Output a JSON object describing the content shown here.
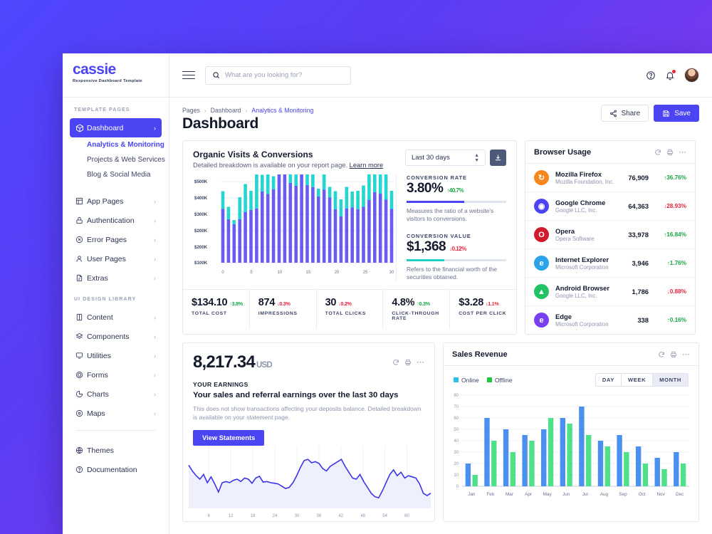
{
  "brand": {
    "name": "cassie",
    "tagline": "Responsive Dashboard Template",
    "accent": "#4a44f2"
  },
  "search": {
    "placeholder": "What are you looking for?",
    "value": ""
  },
  "topbar": {
    "help_icon": "help-circle-icon",
    "bell_icon": "bell-icon",
    "menu_icon": "hamburger-icon"
  },
  "sidebar": {
    "caption_1": "TEMPLATE PAGES",
    "caption_2": "UI DESIGN LIBRARY",
    "items_1": [
      {
        "label": "Dashboard",
        "icon": "cube-icon",
        "active": true,
        "chevron": "›"
      },
      {
        "label": "App Pages",
        "icon": "layout-icon",
        "chevron": "›"
      },
      {
        "label": "Authentication",
        "icon": "lock-icon",
        "chevron": "›"
      },
      {
        "label": "Error Pages",
        "icon": "error-circle-icon",
        "chevron": "›"
      },
      {
        "label": "User Pages",
        "icon": "user-icon",
        "chevron": "›"
      },
      {
        "label": "Extras",
        "icon": "file-icon",
        "chevron": "›"
      }
    ],
    "sub_items": [
      {
        "label": "Analytics & Monitoring",
        "current": true
      },
      {
        "label": "Projects & Web Services",
        "current": false
      },
      {
        "label": "Blog & Social Media",
        "current": false
      }
    ],
    "items_2": [
      {
        "label": "Content",
        "icon": "book-icon",
        "chevron": "›"
      },
      {
        "label": "Components",
        "icon": "layers-icon",
        "chevron": "›"
      },
      {
        "label": "Utilities",
        "icon": "monitor-icon",
        "chevron": "›"
      },
      {
        "label": "Forms",
        "icon": "form-icon",
        "chevron": "›"
      },
      {
        "label": "Charts",
        "icon": "pie-chart-icon",
        "chevron": "›"
      },
      {
        "label": "Maps",
        "icon": "map-pin-icon",
        "chevron": "›"
      }
    ],
    "items_3": [
      {
        "label": "Themes",
        "icon": "palette-icon"
      },
      {
        "label": "Documentation",
        "icon": "question-circle-icon"
      }
    ]
  },
  "breadcrumb": {
    "items": [
      "Pages",
      "Dashboard"
    ],
    "current": "Analytics & Monitoring",
    "sep": "›"
  },
  "page": {
    "title": "Dashboard"
  },
  "actions": {
    "share": "Share",
    "save": "Save",
    "share_icon": "share-icon",
    "save_icon": "save-disk-icon"
  },
  "organic": {
    "title": "Organic Visits & Conversions",
    "subtitle": "Detailed breakdown is available on your report page.",
    "link": "Learn more",
    "range_value": "Last 30 days",
    "download_icon": "download-icon",
    "conversion_rate": {
      "caption": "CONVERSION RATE",
      "value": "3.80%",
      "delta": "40.7%",
      "direction": "up",
      "bar_pct": 58,
      "bar_color": "#4a44f2",
      "note": "Measures the ratio of a website's visitors to conversions."
    },
    "conversion_value": {
      "caption": "CONVERSION VALUE",
      "value": "$1,368",
      "delta": "0.12%",
      "direction": "down",
      "bar_pct": 38,
      "bar_color": "#1fd0c8",
      "note": "Refers to the financial worth of the securities obtained."
    },
    "stats": [
      {
        "value": "$134.10",
        "delta": "3.8%",
        "direction": "up",
        "label": "TOTAL COST"
      },
      {
        "value": "874",
        "delta": "0.3%",
        "direction": "down",
        "label": "IMPRESSIONS"
      },
      {
        "value": "30",
        "delta": "0.2%",
        "direction": "down",
        "label": "TOTAL CLICKS"
      },
      {
        "value": "4.8%",
        "delta": "0.3%",
        "direction": "up",
        "label": "CLICK-THROUGH RATE"
      },
      {
        "value": "$3.28",
        "delta": "1.1%",
        "direction": "down",
        "label": "COST PER CLICK"
      }
    ]
  },
  "browser": {
    "title": "Browser Usage",
    "icons": [
      "refresh-icon",
      "print-icon",
      "more-icon"
    ],
    "rows": [
      {
        "name": "Mozilla Firefox",
        "company": "Mozilla Foundation, Inc.",
        "count": "76,909",
        "pct": "36.76%",
        "direction": "up",
        "color": "#f7861c",
        "glyph": "↻"
      },
      {
        "name": "Google Chrome",
        "company": "Google LLC, Inc.",
        "count": "64,363",
        "pct": "28.93%",
        "direction": "down",
        "color": "#4a44f2",
        "glyph": "◉"
      },
      {
        "name": "Opera",
        "company": "Opera Software",
        "count": "33,978",
        "pct": "16.84%",
        "direction": "up",
        "color": "#d01b2a",
        "glyph": "O"
      },
      {
        "name": "Internet Explorer",
        "company": "Microsoft Corporation",
        "count": "3,946",
        "pct": "1.76%",
        "direction": "up",
        "color": "#2aa3e8",
        "glyph": "e"
      },
      {
        "name": "Android Browser",
        "company": "Google LLC, Inc.",
        "count": "1,786",
        "pct": "0.88%",
        "direction": "down",
        "color": "#21c463",
        "glyph": "▲"
      },
      {
        "name": "Edge",
        "company": "Microsoft Corporation",
        "count": "338",
        "pct": "0.16%",
        "direction": "up",
        "color": "#7b3ff2",
        "glyph": "e"
      }
    ]
  },
  "earnings": {
    "amount": "8,217.34",
    "currency": "USD",
    "caption": "YOUR EARNINGS",
    "subtitle": "Your sales and referral earnings over the last 30 days",
    "note": "This does not show transactions affecting your deposits balance. Detailed breakdown is available on your statement page.",
    "button": "View Statements",
    "icons": [
      "refresh-icon",
      "print-icon",
      "more-icon"
    ]
  },
  "sales": {
    "title": "Sales Revenue",
    "icons": [
      "refresh-icon",
      "print-icon",
      "more-icon"
    ],
    "periods": [
      {
        "label": "DAY",
        "active": false
      },
      {
        "label": "WEEK",
        "active": false
      },
      {
        "label": "MONTH",
        "active": true
      }
    ]
  },
  "chart_data": [
    {
      "type": "bar",
      "id": "organic-visits-conversions",
      "title": "Organic Visits & Conversions",
      "stacked": true,
      "xlabel": "",
      "ylabel": "",
      "ylim": [
        0,
        500
      ],
      "grid": true,
      "ytick_labels": [
        "$500K",
        "$400K",
        "$300K",
        "$200K",
        "$200K",
        "$100K"
      ],
      "ytick_values": [
        500,
        400,
        300,
        200,
        200,
        100
      ],
      "xtick_labels": [
        "0",
        "5",
        "10",
        "15",
        "20",
        "25",
        "30"
      ],
      "x": [
        0,
        1,
        2,
        3,
        4,
        5,
        6,
        7,
        8,
        9,
        10,
        11,
        12,
        13,
        14,
        15,
        16,
        17,
        18,
        19,
        20,
        21,
        22,
        23,
        24,
        25,
        26,
        27,
        28,
        29,
        30
      ],
      "series": [
        {
          "name": "Visits",
          "color": "#6a5bf5",
          "values": [
            151,
            122,
            108,
            122,
            142,
            148,
            152,
            200,
            193,
            206,
            255,
            272,
            224,
            216,
            255,
            218,
            212,
            186,
            205,
            183,
            150,
            130,
            152,
            155,
            150,
            157,
            176,
            198,
            194,
            177,
            151
          ]
        },
        {
          "name": "Conversions",
          "color": "#24d6d0",
          "values": [
            50,
            35,
            12,
            62,
            79,
            54,
            110,
            47,
            80,
            37,
            44,
            72,
            66,
            46,
            44,
            64,
            61,
            22,
            53,
            30,
            51,
            48,
            61,
            45,
            52,
            60,
            82,
            61,
            68,
            72,
            51
          ]
        }
      ]
    },
    {
      "type": "area",
      "id": "your-earnings",
      "title": "Your Earnings",
      "color": "#3b34e8",
      "grid": true,
      "xtick_labels": [
        "6",
        "12",
        "18",
        "24",
        "30",
        "36",
        "42",
        "48",
        "54",
        "60"
      ],
      "x": [
        1,
        2,
        3,
        4,
        5,
        6,
        7,
        8,
        9,
        10,
        11,
        12,
        13,
        14,
        15,
        16,
        17,
        18,
        19,
        20,
        21,
        22,
        23,
        24,
        25,
        26,
        27,
        28,
        29,
        30,
        31,
        32,
        33,
        34,
        35,
        36,
        37,
        38,
        39,
        40,
        41,
        42,
        43,
        44,
        45,
        46,
        47,
        48,
        49,
        50,
        51,
        52,
        53,
        54,
        55,
        56,
        57,
        58,
        59,
        60,
        61,
        62,
        63,
        64,
        65,
        66
      ],
      "values": [
        74,
        64,
        56,
        50,
        58,
        44,
        54,
        42,
        28,
        44,
        46,
        44,
        48,
        50,
        46,
        52,
        50,
        43,
        52,
        55,
        45,
        46,
        44,
        43,
        42,
        38,
        34,
        36,
        44,
        56,
        70,
        82,
        84,
        78,
        80,
        77,
        68,
        64,
        72,
        76,
        80,
        84,
        72,
        62,
        52,
        50,
        58,
        46,
        36,
        26,
        20,
        18,
        30,
        44,
        58,
        66,
        56,
        62,
        52,
        56,
        54,
        52,
        42,
        26,
        22,
        26
      ]
    },
    {
      "type": "bar",
      "id": "sales-revenue",
      "title": "Sales Revenue",
      "grouped": true,
      "ylim": [
        0,
        80
      ],
      "grid": true,
      "ytick_labels": [
        "0",
        "10",
        "20",
        "30",
        "40",
        "50",
        "60",
        "70",
        "80"
      ],
      "ytick_values": [
        0,
        10,
        20,
        30,
        40,
        50,
        60,
        70,
        80
      ],
      "categories": [
        "Jan",
        "Feb",
        "Mar",
        "Apr",
        "May",
        "Jun",
        "Jul",
        "Aug",
        "Sep",
        "Oct",
        "Nov",
        "Dec"
      ],
      "series": [
        {
          "name": "Online",
          "color": "#4a90f0",
          "values": [
            20,
            60,
            50,
            45,
            50,
            60,
            70,
            40,
            45,
            35,
            25,
            30
          ]
        },
        {
          "name": "Offline",
          "color": "#4fe08a",
          "values": [
            10,
            40,
            30,
            40,
            60,
            55,
            45,
            35,
            30,
            20,
            15,
            20
          ]
        }
      ],
      "legend_position": "top-left"
    }
  ]
}
